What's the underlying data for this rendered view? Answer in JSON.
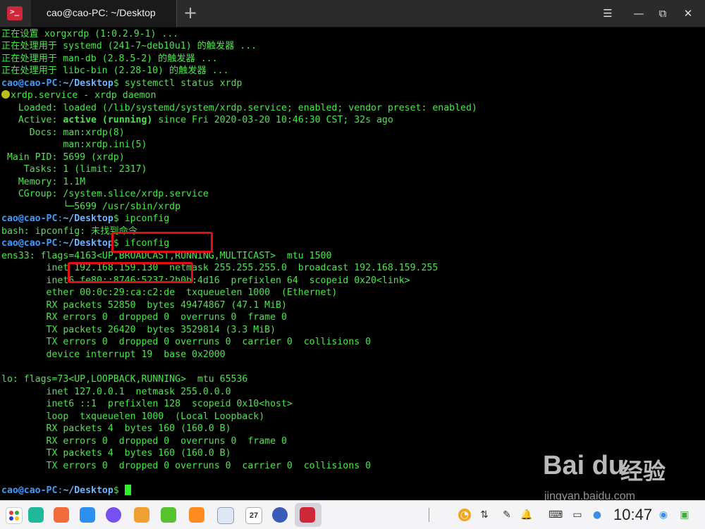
{
  "window": {
    "tab_title": "cao@cao-PC: ~/Desktop",
    "add_tab": "+",
    "minimize": "—",
    "maximize": "⧉",
    "restore": "◱",
    "close": "✕",
    "app_icon": ">_"
  },
  "terminal": {
    "user": "cao@cao-PC",
    "path": "~/Desktop",
    "lines": [
      "正在设置 xorgxrdp (1:0.2.9-1) ...",
      "正在处理用于 systemd (241-7~deb10u1) 的触发器 ...",
      "正在处理用于 man-db (2.8.5-2) 的触发器 ...",
      "正在处理用于 libc-bin (2.28-10) 的触发器 ...",
      "systemctl status xrdp",
      "xrdp.service - xrdp daemon",
      "   Loaded: loaded (/lib/systemd/system/xrdp.service; enabled; vendor preset: enabled)",
      "   Active: ",
      "active (running)",
      " since Fri 2020-03-20 10:46:30 CST; 32s ago",
      "     Docs: man:xrdp(8)",
      "           man:xrdp.ini(5)",
      " Main PID: 5699 (xrdp)",
      "    Tasks: 1 (limit: 2317)",
      "   Memory: 1.1M",
      "   CGroup: /system.slice/xrdp.service",
      "           └─5699 /usr/sbin/xrdp",
      "ipconfig",
      "bash: ipconfig: 未找到命令",
      "ifconfig",
      "ens33: flags=4163<UP,BROADCAST,RUNNING,MULTICAST>  mtu 1500",
      "        inet 192.168.159.130  netmask 255.255.255.0  broadcast 192.168.159.255",
      "        inet6 fe80::8746:5237:2b0b:4d16  prefixlen 64  scopeid 0x20<link>",
      "        ether 00:0c:29:ca:c2:de  txqueuelen 1000  (Ethernet)",
      "        RX packets 52850  bytes 49474867 (47.1 MiB)",
      "        RX errors 0  dropped 0  overruns 0  frame 0",
      "        TX packets 26420  bytes 3529814 (3.3 MiB)",
      "        TX errors 0  dropped 0 overruns 0  carrier 0  collisions 0",
      "        device interrupt 19  base 0x2000",
      "lo: flags=73<UP,LOOPBACK,RUNNING>  mtu 65536",
      "        inet 127.0.0.1  netmask 255.0.0.0",
      "        inet6 ::1  prefixlen 128  scopeid 0x10<host>",
      "        loop  txqueuelen 1000  (Local Loopback)",
      "        RX packets 4  bytes 160 (160.0 B)",
      "        RX errors 0  dropped 0  overruns 0  frame 0",
      "        TX packets 4  bytes 160 (160.0 B)",
      "        TX errors 0  dropped 0 overruns 0  carrier 0  collisions 0"
    ],
    "prompt_sep": ":",
    "prompt_end": "$ "
  },
  "colors": {
    "text": "#4ce64c",
    "prompt_path": "#6fb4ff",
    "highlight": "#e01010",
    "status_dot": "#bdbd19"
  },
  "taskbar": {
    "icons": [
      "launcher-icon",
      "multitasking-icon",
      "file-manager-icon",
      "app-store-icon",
      "browser-icon",
      "photos-icon",
      "music-icon",
      "archive-icon",
      "text-editor-icon",
      "calendar-icon",
      "settings-icon",
      "terminal-icon"
    ],
    "calendar_day": "27",
    "clock": "10:47"
  },
  "watermark": {
    "brand": "Bai du",
    "cn": "经验",
    "url": "jingyan.baidu.com"
  }
}
